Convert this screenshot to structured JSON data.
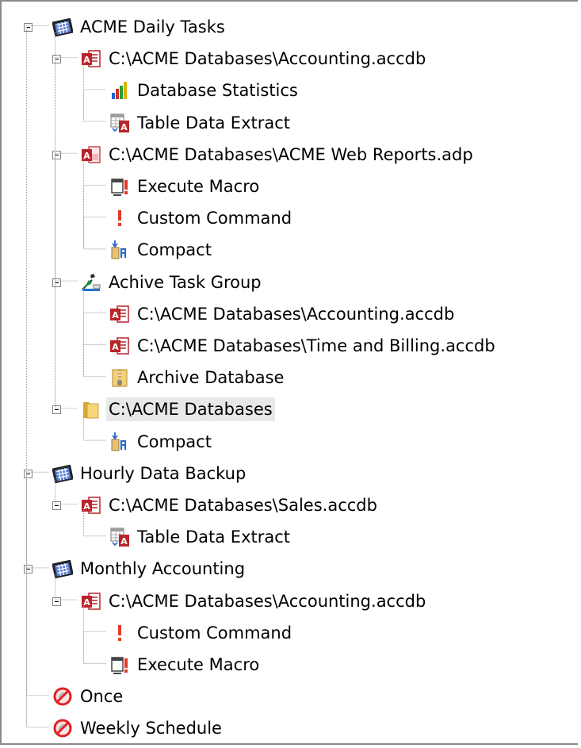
{
  "tree": [
    {
      "label": "ACME Daily Tasks",
      "icon": "schedule-icon",
      "depth": 0,
      "expanded": true
    },
    {
      "label": "C:\\ACME Databases\\Accounting.accdb",
      "icon": "access-db-icon",
      "depth": 1,
      "expanded": true
    },
    {
      "label": "Database Statistics",
      "icon": "bar-chart-icon",
      "depth": 2
    },
    {
      "label": "Table Data Extract",
      "icon": "table-extract-icon",
      "depth": 2
    },
    {
      "label": "C:\\ACME Databases\\ACME Web Reports.adp",
      "icon": "access-adp-icon",
      "depth": 1,
      "expanded": true
    },
    {
      "label": "Execute Macro",
      "icon": "macro-icon",
      "depth": 2
    },
    {
      "label": "Custom Command",
      "icon": "exclamation-icon",
      "depth": 2
    },
    {
      "label": "Compact",
      "icon": "compact-tools-icon",
      "depth": 2
    },
    {
      "label": "Achive Task Group",
      "icon": "task-group-icon",
      "depth": 1,
      "expanded": true
    },
    {
      "label": "C:\\ACME Databases\\Accounting.accdb",
      "icon": "access-db-icon",
      "depth": 2
    },
    {
      "label": "C:\\ACME Databases\\Time and Billing.accdb",
      "icon": "access-db-icon",
      "depth": 2
    },
    {
      "label": "Archive Database",
      "icon": "archive-zip-icon",
      "depth": 2
    },
    {
      "label": "C:\\ACME Databases",
      "icon": "folder-icon",
      "depth": 1,
      "expanded": true,
      "selected": true
    },
    {
      "label": "Compact",
      "icon": "compact-tools-icon",
      "depth": 2
    },
    {
      "label": "Hourly Data Backup",
      "icon": "schedule-icon",
      "depth": 0,
      "expanded": true
    },
    {
      "label": "C:\\ACME Databases\\Sales.accdb",
      "icon": "access-db-icon",
      "depth": 1,
      "expanded": true
    },
    {
      "label": "Table Data Extract",
      "icon": "table-extract-icon",
      "depth": 2
    },
    {
      "label": "Monthly Accounting",
      "icon": "schedule-icon",
      "depth": 0,
      "expanded": true
    },
    {
      "label": "C:\\ACME Databases\\Accounting.accdb",
      "icon": "access-db-icon",
      "depth": 1,
      "expanded": true
    },
    {
      "label": "Custom Command",
      "icon": "exclamation-icon",
      "depth": 2
    },
    {
      "label": "Execute Macro",
      "icon": "macro-icon",
      "depth": 2
    },
    {
      "label": "Once",
      "icon": "disabled-icon",
      "depth": 0
    },
    {
      "label": "Weekly Schedule",
      "icon": "disabled-icon",
      "depth": 0
    }
  ],
  "colors": {
    "access_red": "#b7242a",
    "selection": "#e8e8e8",
    "line": "#a0a0a0"
  }
}
